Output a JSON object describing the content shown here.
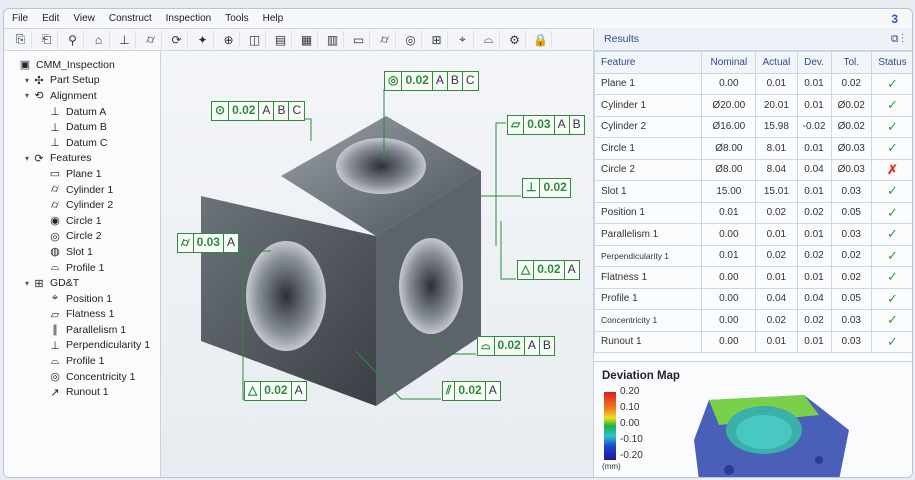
{
  "menu": [
    "File",
    "Edit",
    "View",
    "Construct",
    "Inspection",
    "Tools",
    "Help"
  ],
  "window_badge": "3",
  "toolbar_icons": [
    "new-icon",
    "open-icon",
    "probe-icon",
    "part-icon",
    "align-icon",
    "feature-icon",
    "construct-icon",
    "measure-icon",
    "zoom-icon",
    "view-icon",
    "report-icon",
    "grid-icon",
    "table-icon",
    "plane-icon",
    "cylinder-icon",
    "circle-icon",
    "gdt-icon",
    "scan-icon",
    "profile-icon",
    "settings-icon",
    "lock-icon"
  ],
  "tree": [
    {
      "label": "CMM_Inspection",
      "level": 0,
      "icon": "▣"
    },
    {
      "label": "Part Setup",
      "level": 1,
      "icon": "✣",
      "twisty": true
    },
    {
      "label": "Alignment",
      "level": 1,
      "icon": "⟲",
      "twisty": true
    },
    {
      "label": "Datum A",
      "level": 2,
      "icon": "⊥"
    },
    {
      "label": "Datum B",
      "level": 2,
      "icon": "⊥"
    },
    {
      "label": "Datum C",
      "level": 2,
      "icon": "⊥"
    },
    {
      "label": "Features",
      "level": 1,
      "icon": "⟳",
      "twisty": true
    },
    {
      "label": "Plane 1",
      "level": 2,
      "icon": "▭"
    },
    {
      "label": "Cylinder 1",
      "level": 2,
      "icon": "⌭"
    },
    {
      "label": "Cylinder 2",
      "level": 2,
      "icon": "⌭"
    },
    {
      "label": "Circle 1",
      "level": 2,
      "icon": "◉"
    },
    {
      "label": "Circle 2",
      "level": 2,
      "icon": "◎"
    },
    {
      "label": "Slot 1",
      "level": 2,
      "icon": "◍"
    },
    {
      "label": "Profile 1",
      "level": 2,
      "icon": "⌓"
    },
    {
      "label": "GD&T",
      "level": 1,
      "icon": "⊞",
      "twisty": true
    },
    {
      "label": "Position 1",
      "level": 2,
      "icon": "⌖"
    },
    {
      "label": "Flatness 1",
      "level": 2,
      "icon": "▱"
    },
    {
      "label": "Parallelism 1",
      "level": 2,
      "icon": "∥"
    },
    {
      "label": "Perpendicularity 1",
      "level": 2,
      "icon": "⊥"
    },
    {
      "label": "Profile 1",
      "level": 2,
      "icon": "⌓"
    },
    {
      "label": "Concentricity 1",
      "level": 2,
      "icon": "◎"
    },
    {
      "label": "Runout 1",
      "level": 2,
      "icon": "↗"
    }
  ],
  "callouts": [
    {
      "symbol": "◎",
      "tol": "0.02",
      "datums": [
        "A",
        "B",
        "C"
      ]
    },
    {
      "symbol": "⊙",
      "tol": "0.02",
      "datums": [
        "A",
        "B",
        "C"
      ]
    },
    {
      "symbol": "▱",
      "tol": "0.03",
      "datums": [
        "A",
        "B"
      ]
    },
    {
      "symbol": "⊥",
      "tol": "0.02",
      "datums": []
    },
    {
      "symbol": "⌭",
      "tol": "0.03",
      "datums": [
        "A"
      ]
    },
    {
      "symbol": "△",
      "tol": "0.02",
      "datums": [
        "A"
      ]
    },
    {
      "symbol": "⌓",
      "tol": "0.02",
      "datums": [
        "A",
        "B"
      ]
    },
    {
      "symbol": "△",
      "tol": "0.02",
      "datums": [
        "A"
      ]
    },
    {
      "symbol": "⫽",
      "tol": "0.02",
      "datums": [
        "A"
      ]
    }
  ],
  "results": {
    "title": "Results",
    "columns": [
      "Feature",
      "Nominal",
      "Actual",
      "Dev.",
      "Tol.",
      "Status"
    ],
    "rows": [
      [
        "Plane 1",
        "0.00",
        "0.01",
        "0.01",
        "0.02",
        "pass"
      ],
      [
        "Cylinder 1",
        "Ø20.00",
        "20.01",
        "0.01",
        "Ø0.02",
        "pass"
      ],
      [
        "Cylinder 2",
        "Ø16.00",
        "15.98",
        "-0.02",
        "Ø0.02",
        "pass"
      ],
      [
        "Circle 1",
        "Ø8.00",
        "8.01",
        "0.01",
        "Ø0.03",
        "pass"
      ],
      [
        "Circle 2",
        "Ø8.00",
        "8.04",
        "0.04",
        "Ø0.03",
        "fail"
      ],
      [
        "Slot 1",
        "15.00",
        "15.01",
        "0.01",
        "0.03",
        "pass"
      ],
      [
        "Position 1",
        "0.01",
        "0.02",
        "0.02",
        "0.05",
        "pass"
      ],
      [
        "Parallelism 1",
        "0.00",
        "0.01",
        "0.01",
        "0.03",
        "pass"
      ],
      [
        "Perpendicularity 1",
        "0.01",
        "0.02",
        "0.02",
        "0.02",
        "pass"
      ],
      [
        "Flatness 1",
        "0.00",
        "0.01",
        "0.01",
        "0.02",
        "pass"
      ],
      [
        "Profile 1",
        "0.00",
        "0.04",
        "0.04",
        "0.05",
        "pass"
      ],
      [
        "Concentricity 1",
        "0.00",
        "0.02",
        "0.02",
        "0.03",
        "pass"
      ],
      [
        "Runout 1",
        "0.00",
        "0.01",
        "0.01",
        "0.03",
        "pass"
      ]
    ],
    "status_symbols": {
      "pass": "✓",
      "fail": "✗"
    }
  },
  "deviation": {
    "title": "Deviation Map",
    "ticks": [
      "0.20",
      "0.10",
      "0.00",
      "-0.10",
      "-0.20"
    ],
    "unit": "(mm)"
  },
  "colors": {
    "accent": "#2d4d8a",
    "gdt": "#2f8a3e",
    "pass": "#2e9a3a",
    "fail": "#e0312a"
  }
}
